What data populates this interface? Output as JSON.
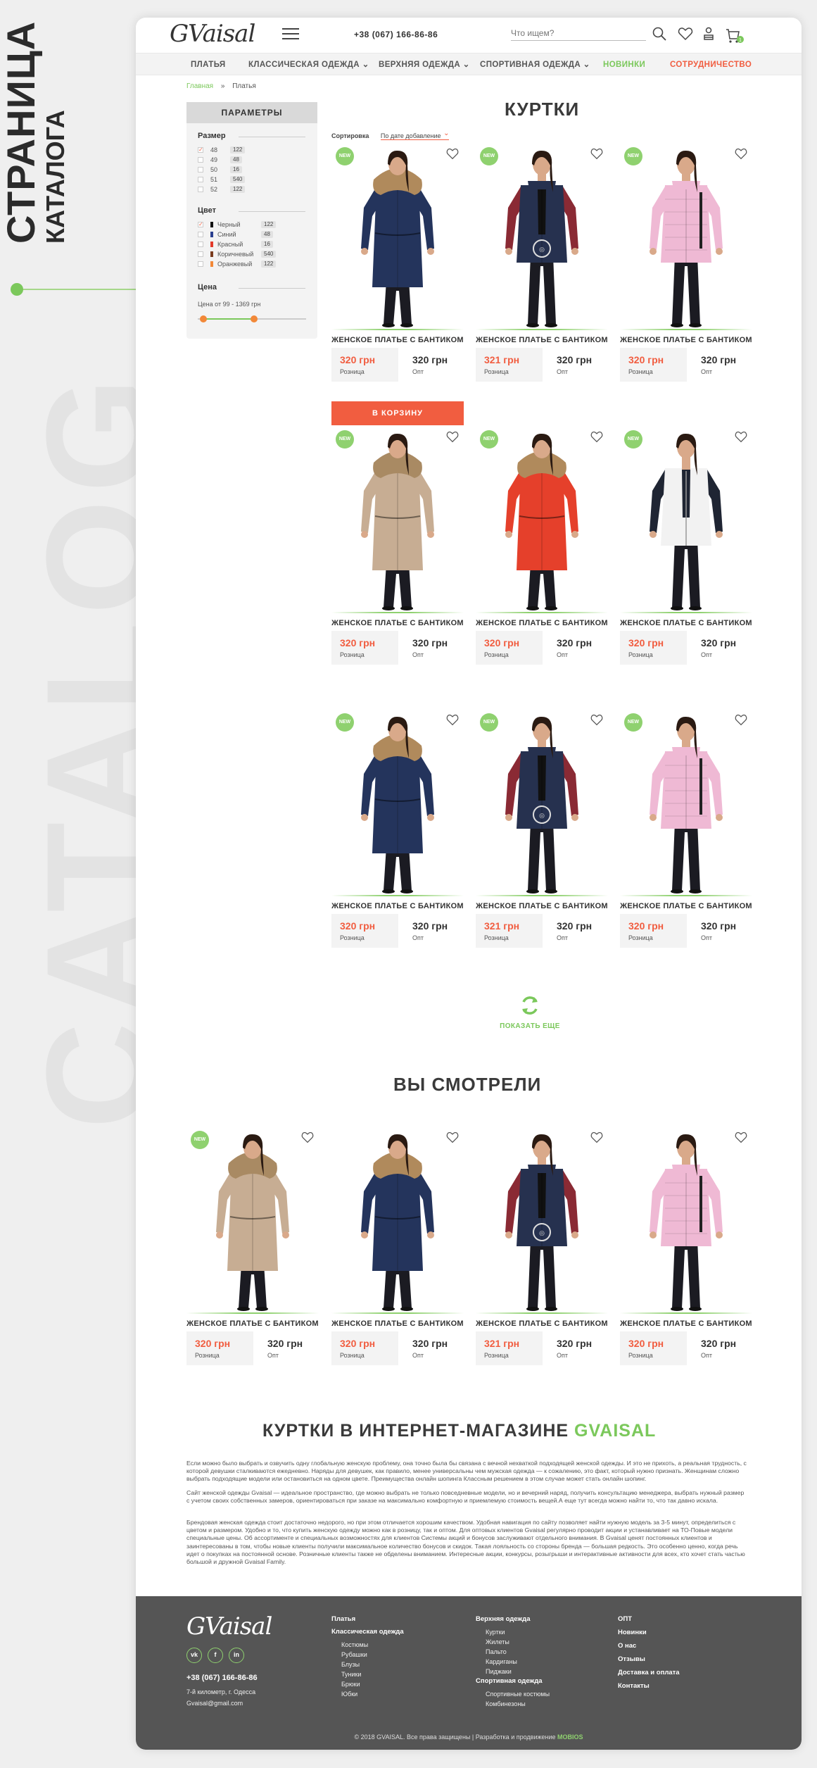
{
  "side": {
    "line1": "СТРАНИЦА",
    "line2": "КАТАЛОГА",
    "watermark": "CATALOG"
  },
  "header": {
    "logo": "GVaisal",
    "phone": "+38 (067) 166-86-86",
    "search_placeholder": "Что ищем?",
    "cart_count": "1",
    "icons": [
      "search-icon",
      "heart-icon",
      "user-icon",
      "cart-icon",
      "menu-icon"
    ]
  },
  "nav": [
    {
      "label": "ПЛАТЬЯ"
    },
    {
      "label": "КЛАССИЧЕСКАЯ ОДЕЖДА ⌄"
    },
    {
      "label": "ВЕРХНЯЯ ОДЕЖДА ⌄"
    },
    {
      "label": "СПОРТИВНАЯ ОДЕЖДА ⌄"
    },
    {
      "label": "НОВИНКИ",
      "color": "#7bc85b"
    },
    {
      "label": "СОТРУДНИЧЕСТВО",
      "color": "#f15d40"
    }
  ],
  "breadcrumb": {
    "home": "Главная",
    "sep": "»",
    "current": "Платья"
  },
  "filters": {
    "title": "ПАРАМЕТРЫ",
    "size_title": "Размер",
    "sizes": [
      {
        "label": "48",
        "count": "122",
        "checked": true
      },
      {
        "label": "49",
        "count": "48",
        "checked": false
      },
      {
        "label": "50",
        "count": "16",
        "checked": false
      },
      {
        "label": "51",
        "count": "540",
        "checked": false
      },
      {
        "label": "52",
        "count": "122",
        "checked": false
      }
    ],
    "color_title": "Цвет",
    "colors": [
      {
        "label": "Черный",
        "count": "122",
        "swatch": "#111111",
        "checked": true
      },
      {
        "label": "Синий",
        "count": "48",
        "swatch": "#2a3f8f",
        "checked": false
      },
      {
        "label": "Красный",
        "count": "16",
        "swatch": "#e23a2a",
        "checked": false
      },
      {
        "label": "Коричневый",
        "count": "540",
        "swatch": "#7a3b1e",
        "checked": false
      },
      {
        "label": "Оранжевый",
        "count": "122",
        "swatch": "#f28838",
        "checked": false
      }
    ],
    "price_title": "Цена",
    "price_range": "Цена от 99 - 1369 грн",
    "price_slider": {
      "min": 99,
      "max": 1369,
      "from_fraction": 0.05,
      "to_fraction": 0.52
    }
  },
  "catalog": {
    "title": "КУРТКИ",
    "sort_label": "Сортировка",
    "sort_value": "По дате добавление",
    "cart_button": "В КОРЗИНУ",
    "show_more": "ПОКАЗАТЬ ЕЩЕ"
  },
  "products": [
    {
      "name": "ЖЕНСКОЕ ПЛАТЬЕ С БАНТИКОМ",
      "badge": "NEW",
      "jacket": "navy-parka",
      "price_retail": "320 грн",
      "retail_label": "Розница",
      "price_opt": "320 грн",
      "opt_label": "Опт"
    },
    {
      "name": "ЖЕНСКОЕ ПЛАТЬЕ С БАНТИКОМ",
      "badge": "NEW",
      "jacket": "burgundy-bomber",
      "price_retail": "321 грн",
      "retail_label": "Розница",
      "price_opt": "320 грн",
      "opt_label": "Опт"
    },
    {
      "name": "ЖЕНСКОЕ ПЛАТЬЕ С БАНТИКОМ",
      "badge": "NEW",
      "jacket": "pink-puffer",
      "price_retail": "320 грн",
      "retail_label": "Розница",
      "price_opt": "320 грн",
      "opt_label": "Опт"
    },
    {
      "name": "ЖЕНСКОЕ ПЛАТЬЕ С БАНТИКОМ",
      "badge": "NEW",
      "jacket": "beige-parka",
      "price_retail": "320 грн",
      "retail_label": "Розница",
      "price_opt": "320 грн",
      "opt_label": "Опт"
    },
    {
      "name": "ЖЕНСКОЕ ПЛАТЬЕ С БАНТИКОМ",
      "badge": "NEW",
      "jacket": "red-parka",
      "price_retail": "320 грн",
      "retail_label": "Розница",
      "price_opt": "320 грн",
      "opt_label": "Опт"
    },
    {
      "name": "ЖЕНСКОЕ ПЛАТЬЕ С БАНТИКОМ",
      "badge": "NEW",
      "jacket": "white-vest",
      "price_retail": "320 грн",
      "retail_label": "Розница",
      "price_opt": "320 грн",
      "opt_label": "Опт"
    },
    {
      "name": "ЖЕНСКОЕ ПЛАТЬЕ С БАНТИКОМ",
      "badge": "NEW",
      "jacket": "navy-parka",
      "price_retail": "320 грн",
      "retail_label": "Розница",
      "price_opt": "320 грн",
      "opt_label": "Опт"
    },
    {
      "name": "ЖЕНСКОЕ ПЛАТЬЕ С БАНТИКОМ",
      "badge": "NEW",
      "jacket": "burgundy-bomber",
      "price_retail": "321 грн",
      "retail_label": "Розница",
      "price_opt": "320 грн",
      "opt_label": "Опт"
    },
    {
      "name": "ЖЕНСКОЕ ПЛАТЬЕ С БАНТИКОМ",
      "badge": "NEW",
      "jacket": "pink-puffer",
      "price_retail": "320 грн",
      "retail_label": "Розница",
      "price_opt": "320 грн",
      "opt_label": "Опт"
    }
  ],
  "viewed": {
    "title": "ВЫ СМОТРЕЛИ",
    "items": [
      {
        "name": "ЖЕНСКОЕ ПЛАТЬЕ С БАНТИКОМ",
        "badge": "NEW",
        "jacket": "beige-parka",
        "price_retail": "320 грн",
        "retail_label": "Розница",
        "price_opt": "320 грн",
        "opt_label": "Опт"
      },
      {
        "name": "ЖЕНСКОЕ ПЛАТЬЕ С БАНТИКОМ",
        "badge": "",
        "jacket": "navy-parka",
        "price_retail": "320 грн",
        "retail_label": "Розница",
        "price_opt": "320 грн",
        "opt_label": "Опт"
      },
      {
        "name": "ЖЕНСКОЕ ПЛАТЬЕ С БАНТИКОМ",
        "badge": "",
        "jacket": "burgundy-bomber",
        "price_retail": "321 грн",
        "retail_label": "Розница",
        "price_opt": "320 грн",
        "opt_label": "Опт"
      },
      {
        "name": "ЖЕНСКОЕ ПЛАТЬЕ С БАНТИКОМ",
        "badge": "",
        "jacket": "pink-puffer",
        "price_retail": "320 грн",
        "retail_label": "Розница",
        "price_opt": "320 грн",
        "opt_label": "Опт"
      }
    ]
  },
  "seo": {
    "title_main": "КУРТКИ В ИНТЕРНЕТ-МАГАЗИНЕ ",
    "title_brand": "GVAISAL",
    "p1": "Если можно было выбрать и озвучить одну глобальную женскую проблему, она точно была бы связана с вечной нехваткой подходящей женской одежды. И это не прихоть, а реальная трудность, с которой девушки сталкиваются ежедневно. Наряды для девушек, как правило, менее универсальны чем мужская одежда — к сожалению, это факт, который нужно признать. Женщинам сложно выбрать подходящие модели или остановиться на одном цвете. Преимущества онлайн шопинга Классным решением в этом случае может стать онлайн шопинг.",
    "p2": "Сайт женской одежды Gvaisal — идеальное пространство, где можно выбрать не только повседневные модели, но и вечерний наряд, получить консультацию менеджера, выбрать нужный размер с учетом своих собственных замеров, ориентироваться при заказе на максимально комфортную и приемлемую стоимость вещей.А еще тут всегда можно найти то, что так давно искала.",
    "p3": "Брендовая женская одежда стоит достаточно недорого, но при этом отличается хорошим качеством. Удобная навигация по сайту позволяет найти нужную модель за 3-5 минут, определиться с цветом и размером. Удобно и то, что купить женскую одежду можно как в розницу, так и оптом. Для оптовых клиентов Gvaisal регулярно проводит акции и устанавливает на ТО-Повые модели специальные цены. Об ассортименте и специальных возможностях для клиентов Системы акций и бонусов заслуживают отдельного внимания. В Gvaisal ценят постоянных клиентов и заинтересованы в том, чтобы новые клиенты получили максимальное количество бонусов и скидок. Такая лояльность со стороны бренда — большая редкость. Это особенно ценно, когда речь идет о покупках на постоянной основе. Розничные клиенты также не обделены вниманием. Интересные акции, конкурсы, розыгрыши и интерактивные активности для всех, кто хочет стать частью большой и дружной Gvaisal Family."
  },
  "footer": {
    "logo": "GVaisal",
    "social": [
      "vk",
      "f",
      "in"
    ],
    "phone": "+38 (067) 166-86-86",
    "address": "7-й километр, г. Одесса",
    "email": "Gvaisal@gmail.com",
    "col1": {
      "h1": "Платья",
      "h2": "Классическая одежда",
      "items": [
        "Костюмы",
        "Рубашки",
        "Блузы",
        "Туники",
        "Брюки",
        "Юбки"
      ]
    },
    "col2": {
      "h1": "Верхняя одежда",
      "items": [
        "Куртки",
        "Жилеты",
        "Пальто",
        "Кардиганы",
        "Пиджаки"
      ],
      "h2": "Спортивная одежда",
      "items2": [
        "Спортивные костюмы",
        "Комбинезоны"
      ]
    },
    "col3": [
      "ОПТ",
      "Новинки",
      "О нас",
      "Отзывы",
      "Доставка и оплата",
      "Контакты"
    ],
    "copyright": "© 2018 GVAISAL. Все права защищены | Разработка и продвижение ",
    "developer": "MOBIOS"
  },
  "colors": {
    "accent_green": "#7bc85b",
    "accent_red": "#f15d40",
    "footer_bg": "#555555"
  }
}
